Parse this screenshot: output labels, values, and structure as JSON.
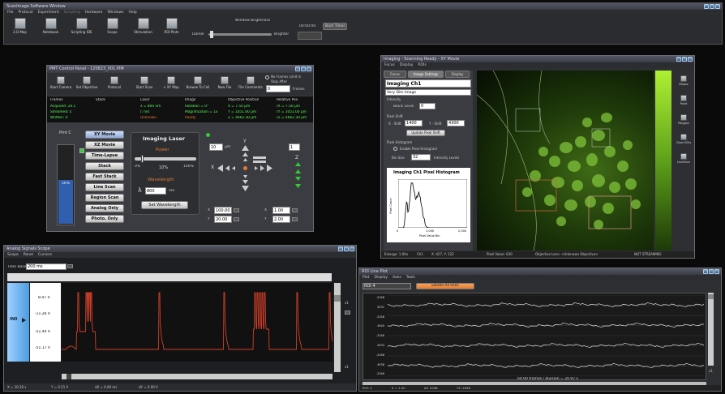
{
  "app": {
    "title": "ScanImage Software Window",
    "menu": [
      "File",
      "Protocol",
      "Experiment",
      "Scripting",
      "Hardware",
      "Windows",
      "Help"
    ],
    "toolbar": [
      "2-D Map",
      "Notebook",
      "Scripting IDE",
      "Scope",
      "Stimulation",
      "ROI Plots"
    ],
    "brightness": {
      "label": "Window Brightness",
      "darker": "Darker",
      "brighter": "Brighter"
    },
    "timer": {
      "value": "00:00:00",
      "button": "Start Timer"
    }
  },
  "pcp": {
    "title": "PMT Control Panel - 120823_001.PIM",
    "tools": [
      "Start Camera",
      "Set Objective",
      "Protocol",
      "Start Scan",
      "+ XY Map",
      "Browse To Cell",
      "New File",
      "File Comments"
    ],
    "frames_label": "No Frames Limit in",
    "stop_after": "Stop After",
    "frames_value": "0",
    "frames_unit": "Frames",
    "headers": [
      "Frames",
      "Stack",
      "Laser",
      "Image",
      "Objective Position",
      "Relative Pos."
    ],
    "col_frames": [
      "Acquired: 20.1",
      "Streamed: 0",
      "Written: 0"
    ],
    "col_laser": [
      "λ = 800 nm",
      "I: n/d",
      "Unknown"
    ],
    "col_image": [
      "Rotation = 0°",
      "Magnification = 1x",
      "Ready"
    ],
    "col_obj": [
      "X = 7.50 μm",
      "Y = 1051.00 μm",
      "Z = 4662.30 μm"
    ],
    "col_rel": [
      "rX = 7.50 μm",
      "rY = 1051.00 μm",
      "rZ = 4662.30 μm"
    ],
    "pmt_label": "Pmt C",
    "pmt_value": "56%",
    "modes": [
      "XY Movie",
      "XZ Movie",
      "Time-Lapse",
      "Stack",
      "Fast Stack",
      "Line Scan",
      "Region Scan",
      "Analog Only",
      "Photo. Only"
    ],
    "laser": {
      "title": "Imaging Laser",
      "power": "Power",
      "p0": "0%",
      "p1": "10%",
      "p2": "100%",
      "wavelength": "Wavelength",
      "lambda": "λ",
      "wl_value": "800",
      "wl_unit": "nm",
      "set_btn": "Set Wavelength"
    },
    "stage": {
      "step": "10",
      "step_unit": "μm",
      "zstep": "1",
      "x1": "100.00",
      "y1": "20.00",
      "x2": "1.00",
      "y2": "2.00",
      "xlab": "X",
      "ylab": "Y",
      "zlab": "Z"
    }
  },
  "scan": {
    "title": "Imaging - Scanning Ready - XY Movie",
    "tabs": [
      "Focus",
      "Display",
      "ROIs"
    ],
    "subtabs": [
      "Focus",
      "Image Settings",
      "Display"
    ],
    "channel": "Imaging Ch1",
    "preset": "Very Dim Image",
    "intensity": "Intensity",
    "black_level": "Black Level",
    "black_value": "0",
    "pixel_shift": "Pixel Shift",
    "xshift_lab": "X - Shift",
    "xshift": "1400",
    "yshift_lab": "Y - Shift",
    "yshift": "4300",
    "update_btn": "Update Pixel Shift",
    "hist_label": "Pixel Histogram",
    "enable": "Enable Pixel Histogram",
    "bin_label": "Bin Size",
    "bin": "32",
    "levels": "Intensity Levels",
    "hist_title": "Imaging Ch1 Pixel Histogram",
    "hist_y": "Pixel Count",
    "hist_x": "Pixel Value Bin",
    "hist_ticks": [
      "0",
      "1,000",
      "2,000"
    ],
    "status": [
      "Enlarge: 1.00x",
      "Ch1",
      "X: 427, Y: 122",
      "Pixel Value: 630",
      "Objective Lens: <Unknown Objective>",
      "NOT STREAMING"
    ],
    "side_tools": [
      "Ellipse",
      "Point",
      "Polygon",
      "Clear ROIs",
      "LineScan"
    ]
  },
  "scope": {
    "title": "Analog Signals Scope",
    "menu": [
      "Scope",
      "Panel",
      "Cursors"
    ],
    "timebase_label": "Time Base",
    "timebase": "200 ms",
    "ch": "IN0",
    "labels": [
      "8.47 V",
      "-11.26 V",
      "-51.44 V",
      "-51.17 V"
    ],
    "status": [
      "X = 10.20 s",
      "Y = 0.21 V",
      "dX = 0.00 ms",
      "dY = 0.00 V"
    ],
    "right": [
      "x1",
      "x1"
    ]
  },
  "roi": {
    "title": "ROI Line Plot",
    "menu": [
      "Plot",
      "Display",
      "Axes",
      "Tools"
    ],
    "select": "ROI 4",
    "delete_btn": "Delete All ROIs",
    "ylabels": [
      "-2048",
      "5031",
      "-2048",
      "4940",
      "-2048",
      "4934",
      "-2048",
      "4938",
      "-2048"
    ],
    "footer": "64.00 frames / division = 20.97 s",
    "status": [
      "ROI: 4",
      "X = 1.00",
      "ΔY: 2048",
      "Y2: 2048"
    ],
    "zoom": "x1"
  },
  "colors": {
    "accent": "#e57a2e",
    "trace": "#d0402a",
    "bar": "#2f5fae",
    "green": "#5f5"
  }
}
